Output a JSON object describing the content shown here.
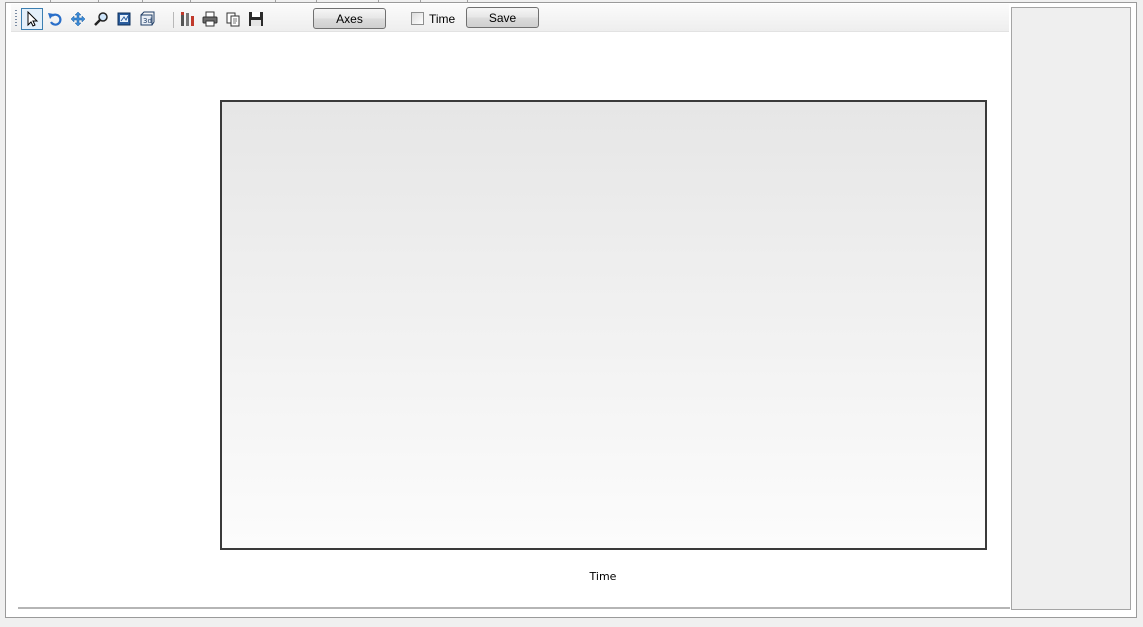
{
  "toolbar": {
    "tools": [
      {
        "name": "pointer-icon",
        "active": true
      },
      {
        "name": "undo-icon"
      },
      {
        "name": "pan-icon"
      },
      {
        "name": "zoom-icon"
      },
      {
        "name": "zoom-box-icon"
      },
      {
        "name": "3d-view-icon"
      },
      {
        "name": "chart-properties-icon"
      },
      {
        "name": "print-icon"
      },
      {
        "name": "copy-icon"
      },
      {
        "name": "save-icon"
      }
    ],
    "axes_label": "Axes",
    "time_checkbox": {
      "label": "Time",
      "checked": false
    },
    "save_label": "Save"
  },
  "chart": {
    "xlabel": "Time"
  },
  "chart_data": {
    "type": "line",
    "series": [],
    "xlabel": "Time",
    "ylabel": "",
    "grid": false
  }
}
